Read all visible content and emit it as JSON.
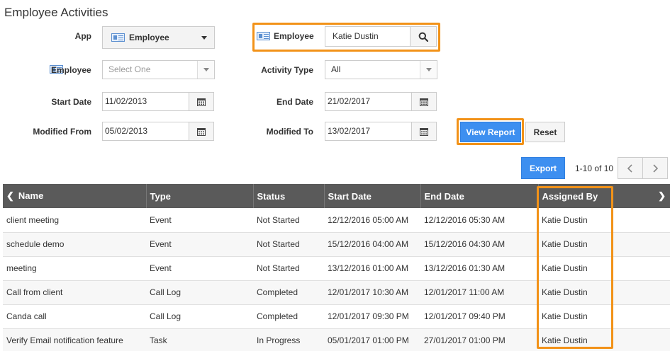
{
  "page": {
    "title": "Employee Activities"
  },
  "filters": {
    "app_label": "App",
    "app_value": "Employee",
    "employee_label": "Employee",
    "employee_value": "Katie Dustin",
    "employee2_label": "Employee",
    "employee2_placeholder": "Select One",
    "activity_type_label": "Activity Type",
    "activity_type_value": "All",
    "start_date_label": "Start Date",
    "start_date_value": "11/02/2013",
    "end_date_label": "End Date",
    "end_date_value": "21/02/2017",
    "modified_from_label": "Modified From",
    "modified_from_value": "05/02/2013",
    "modified_to_label": "Modified To",
    "modified_to_value": "13/02/2017"
  },
  "actions": {
    "view_report": "View Report",
    "reset": "Reset",
    "export": "Export"
  },
  "pagination": {
    "text": "1-10 of 10"
  },
  "table": {
    "headers": [
      "Name",
      "Type",
      "Status",
      "Start Date",
      "End Date",
      "Assigned By"
    ],
    "rows": [
      [
        "client meeting",
        "Event",
        "Not Started",
        "12/12/2016 05:00 AM",
        "12/12/2016 05:30 AM",
        "Katie Dustin"
      ],
      [
        "schedule demo",
        "Event",
        "Not Started",
        "15/12/2016 04:00 AM",
        "15/12/2016 04:30 AM",
        "Katie Dustin"
      ],
      [
        "meeting",
        "Event",
        "Not Started",
        "13/12/2016 01:00 AM",
        "13/12/2016 01:30 AM",
        "Katie Dustin"
      ],
      [
        "Call from client",
        "Call Log",
        "Completed",
        "12/01/2017 10:30 AM",
        "12/01/2017 11:00 AM",
        "Katie Dustin"
      ],
      [
        "Canda call",
        "Call Log",
        "Completed",
        "12/01/2017 09:30 PM",
        "12/01/2017 09:40 PM",
        "Katie Dustin"
      ],
      [
        "Verify Email notification feature",
        "Task",
        "In Progress",
        "05/01/2017 01:00 PM",
        "27/01/2017 01:00 PM",
        "Katie Dustin"
      ]
    ]
  },
  "colors": {
    "primary": "#3d8ff0",
    "highlight": "#f29218",
    "header_bg": "#5a5a5a"
  },
  "icons": {
    "calendar": "calendar-icon",
    "search": "search-icon",
    "card": "id-card-icon"
  }
}
